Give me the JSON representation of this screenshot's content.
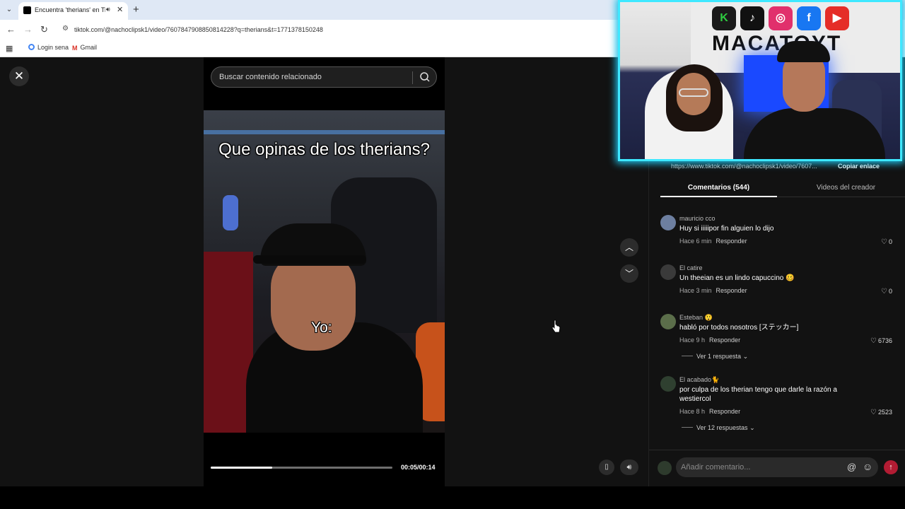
{
  "browser": {
    "tab_title": "Encuentra 'therians' en TikTok",
    "url": "tiktok.com/@nachoclipsk1/video/7607847908850814228?q=therians&t=1771378150248",
    "bookmarks": [
      "Login sena",
      "Gmail"
    ]
  },
  "search": {
    "placeholder": "Buscar contenido relacionado"
  },
  "video": {
    "caption": "Que opinas de los therians?",
    "overlay_label": "Yo:",
    "time": "00:05/00:14",
    "progress": 0.34
  },
  "panel": {
    "share_link": "https://www.tiktok.com/@nachoclipsk1/video/7607...",
    "copy_link_label": "Copiar enlace",
    "tab_comments": "Comentarios (544)",
    "tab_videos": "Videos del creador",
    "reply_label": "Responder",
    "comments": [
      {
        "user": "mauricio cco",
        "text": "Huy si iiiiipor fin alguien lo dijo",
        "time": "Hace 6 min",
        "likes": "0",
        "more": ""
      },
      {
        "user": "El catire",
        "text": "Un theeian es un lindo capuccino 🥴",
        "time": "Hace 3 min",
        "likes": "0",
        "more": ""
      },
      {
        "user": "Esteban 😲",
        "text": "habló por todos nosotros [ステッカー]",
        "time": "Hace 9 h",
        "likes": "6736",
        "more": "Ver 1 respuesta"
      },
      {
        "user": "El acabado🐈",
        "text": "por culpa de los therian tengo que darle la razón a westiercol",
        "time": "Hace 8 h",
        "likes": "2523",
        "more": "Ver 12 respuestas"
      }
    ],
    "comment_placeholder": "Añadir comentario..."
  },
  "webcam": {
    "brand": "MACATOYT"
  },
  "colors": {
    "accent_send": "#b21c33",
    "webcam_border": "#3ee8ff"
  },
  "icons": [
    "close-icon",
    "search-icon",
    "chevron-up-icon",
    "chevron-down-icon",
    "heart-icon",
    "at-icon",
    "emoji-icon",
    "send-icon",
    "volume-icon",
    "report-icon",
    "cursor-icon"
  ]
}
